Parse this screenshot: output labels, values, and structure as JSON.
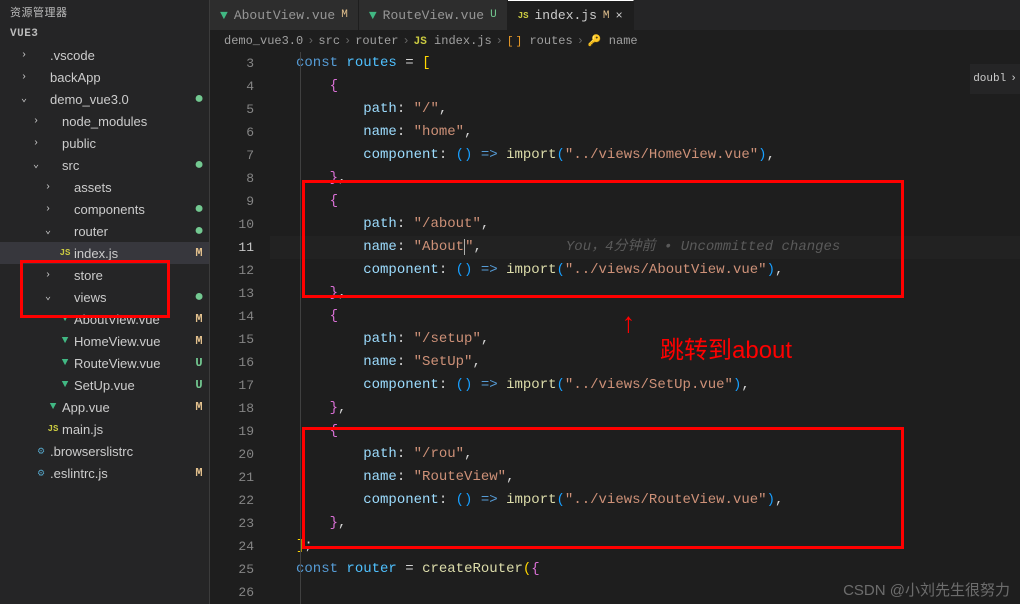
{
  "sidebar": {
    "title": "VUE3",
    "explorerHeader": "资源管理器",
    "items": [
      {
        "type": "folder",
        "label": ".vscode",
        "indent": 1,
        "expanded": false,
        "badge": ""
      },
      {
        "type": "folder",
        "label": "backApp",
        "indent": 1,
        "expanded": false,
        "badge": ""
      },
      {
        "type": "folder",
        "label": "demo_vue3.0",
        "indent": 1,
        "expanded": true,
        "badge": "dot"
      },
      {
        "type": "folder",
        "label": "node_modules",
        "indent": 2,
        "expanded": false,
        "badge": ""
      },
      {
        "type": "folder",
        "label": "public",
        "indent": 2,
        "expanded": false,
        "badge": ""
      },
      {
        "type": "folder",
        "label": "src",
        "indent": 2,
        "expanded": true,
        "badge": "dot"
      },
      {
        "type": "folder",
        "label": "assets",
        "indent": 3,
        "expanded": false,
        "badge": ""
      },
      {
        "type": "folder",
        "label": "components",
        "indent": 3,
        "expanded": false,
        "badge": "dot"
      },
      {
        "type": "folder",
        "label": "router",
        "indent": 3,
        "expanded": true,
        "badge": "dot"
      },
      {
        "type": "file",
        "label": "index.js",
        "indent": 3,
        "icon": "js",
        "badge": "M",
        "active": true
      },
      {
        "type": "folder",
        "label": "store",
        "indent": 3,
        "expanded": false,
        "badge": ""
      },
      {
        "type": "folder",
        "label": "views",
        "indent": 3,
        "expanded": true,
        "badge": "dot"
      },
      {
        "type": "file",
        "label": "AboutView.vue",
        "indent": 3,
        "icon": "vue",
        "badge": "M"
      },
      {
        "type": "file",
        "label": "HomeView.vue",
        "indent": 3,
        "icon": "vue",
        "badge": "M"
      },
      {
        "type": "file",
        "label": "RouteView.vue",
        "indent": 3,
        "icon": "vue",
        "badge": "U"
      },
      {
        "type": "file",
        "label": "SetUp.vue",
        "indent": 3,
        "icon": "vue",
        "badge": "U"
      },
      {
        "type": "file",
        "label": "App.vue",
        "indent": 2,
        "icon": "vue",
        "badge": "M"
      },
      {
        "type": "file",
        "label": "main.js",
        "indent": 2,
        "icon": "js",
        "badge": ""
      },
      {
        "type": "file",
        "label": ".browserslistrc",
        "indent": 1,
        "icon": "config",
        "badge": ""
      },
      {
        "type": "file",
        "label": ".eslintrc.js",
        "indent": 1,
        "icon": "config",
        "badge": "M"
      }
    ]
  },
  "tabs": [
    {
      "icon": "vue",
      "label": "AboutView.vue",
      "badge": "M",
      "active": false
    },
    {
      "icon": "vue",
      "label": "RouteView.vue",
      "badge": "U",
      "active": false
    },
    {
      "icon": "js",
      "label": "index.js",
      "badge": "M",
      "active": true,
      "closable": true
    }
  ],
  "breadcrumb": [
    {
      "label": "demo_vue3.0"
    },
    {
      "label": "src"
    },
    {
      "label": "router"
    },
    {
      "icon": "JS",
      "label": "index.js"
    },
    {
      "icon": "[]",
      "label": "routes"
    },
    {
      "icon": "key",
      "label": "name"
    }
  ],
  "minimap": {
    "action": "doubl"
  },
  "code": {
    "lines": [
      {
        "n": 3,
        "html": "<span class='tk-keyword'>const</span> <span class='tk-const'>routes</span> <span class='tk-punct'>=</span> <span class='tk-bracket-y'>[</span>"
      },
      {
        "n": 4,
        "html": "    <span class='tk-bracket-p'>{</span>"
      },
      {
        "n": 5,
        "html": "        <span class='tk-property'>path</span><span class='tk-punct'>:</span> <span class='tk-string'>\"/\"</span><span class='tk-punct'>,</span>"
      },
      {
        "n": 6,
        "html": "        <span class='tk-property'>name</span><span class='tk-punct'>:</span> <span class='tk-string'>\"home\"</span><span class='tk-punct'>,</span>"
      },
      {
        "n": 7,
        "html": "        <span class='tk-property'>component</span><span class='tk-punct'>:</span> <span class='tk-bracket-b'>()</span> <span class='tk-keyword'>=></span> <span class='tk-function'>import</span><span class='tk-bracket-b'>(</span><span class='tk-string'>\"../views/HomeView.vue\"</span><span class='tk-bracket-b'>)</span><span class='tk-punct'>,</span>"
      },
      {
        "n": 8,
        "html": "    <span class='tk-bracket-p'>}</span><span class='tk-punct'>,</span>"
      },
      {
        "n": 9,
        "html": "    <span class='tk-bracket-p'>{</span>"
      },
      {
        "n": 10,
        "html": "        <span class='tk-property'>path</span><span class='tk-punct'>:</span> <span class='tk-string'>\"/about\"</span><span class='tk-punct'>,</span>"
      },
      {
        "n": 11,
        "html": "        <span class='tk-property'>name</span><span class='tk-punct'>:</span> <span class='tk-string'>\"About<span class='cursor'></span>\"</span><span class='tk-punct'>,</span>          <span class='tk-blame'>You，4分钟前 • Uncommitted changes</span>",
        "current": true
      },
      {
        "n": 12,
        "html": "        <span class='tk-property'>component</span><span class='tk-punct'>:</span> <span class='tk-bracket-b'>()</span> <span class='tk-keyword'>=></span> <span class='tk-function'>import</span><span class='tk-bracket-b'>(</span><span class='tk-string'>\"../views/AboutView.vue\"</span><span class='tk-bracket-b'>)</span><span class='tk-punct'>,</span>"
      },
      {
        "n": 13,
        "html": "    <span class='tk-bracket-p'>}</span><span class='tk-punct'>,</span>"
      },
      {
        "n": 14,
        "html": "    <span class='tk-bracket-p'>{</span>"
      },
      {
        "n": 15,
        "html": "        <span class='tk-property'>path</span><span class='tk-punct'>:</span> <span class='tk-string'>\"/setup\"</span><span class='tk-punct'>,</span>"
      },
      {
        "n": 16,
        "html": "        <span class='tk-property'>name</span><span class='tk-punct'>:</span> <span class='tk-string'>\"SetUp\"</span><span class='tk-punct'>,</span>"
      },
      {
        "n": 17,
        "html": "        <span class='tk-property'>component</span><span class='tk-punct'>:</span> <span class='tk-bracket-b'>()</span> <span class='tk-keyword'>=></span> <span class='tk-function'>import</span><span class='tk-bracket-b'>(</span><span class='tk-string'>\"../views/SetUp.vue\"</span><span class='tk-bracket-b'>)</span><span class='tk-punct'>,</span>"
      },
      {
        "n": 18,
        "html": "    <span class='tk-bracket-p'>}</span><span class='tk-punct'>,</span>"
      },
      {
        "n": 19,
        "html": "    <span class='tk-bracket-p'>{</span>"
      },
      {
        "n": 20,
        "html": "        <span class='tk-property'>path</span><span class='tk-punct'>:</span> <span class='tk-string'>\"/rou\"</span><span class='tk-punct'>,</span>"
      },
      {
        "n": 21,
        "html": "        <span class='tk-property'>name</span><span class='tk-punct'>:</span> <span class='tk-string'>\"RouteView\"</span><span class='tk-punct'>,</span>"
      },
      {
        "n": 22,
        "html": "        <span class='tk-property'>component</span><span class='tk-punct'>:</span> <span class='tk-bracket-b'>()</span> <span class='tk-keyword'>=></span> <span class='tk-function'>import</span><span class='tk-bracket-b'>(</span><span class='tk-string'>\"../views/RouteView.vue\"</span><span class='tk-bracket-b'>)</span><span class='tk-punct'>,</span>"
      },
      {
        "n": 23,
        "html": "    <span class='tk-bracket-p'>}</span><span class='tk-punct'>,</span>"
      },
      {
        "n": 24,
        "html": "<span class='tk-bracket-y'>]</span><span class='tk-punct'>;</span>"
      },
      {
        "n": 25,
        "html": ""
      },
      {
        "n": 26,
        "html": "<span class='tk-keyword'>const</span> <span class='tk-const'>router</span> <span class='tk-punct'>=</span> <span class='tk-function'>createRouter</span><span class='tk-bracket-y'>(</span><span class='tk-bracket-p'>{</span>"
      }
    ]
  },
  "annotation": {
    "text": "跳转到about"
  },
  "watermark": "CSDN @小刘先生很努力"
}
